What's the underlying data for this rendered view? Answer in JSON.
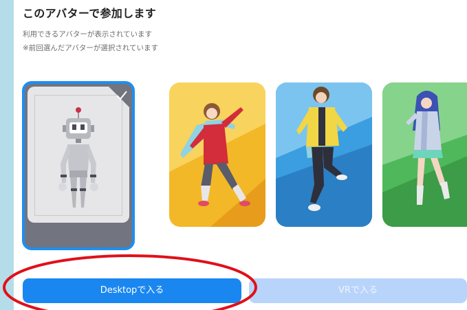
{
  "header": {
    "title": "このアバターで参加します",
    "subtitle_line1": "利用できるアバターが表示されています",
    "subtitle_line2": "※前回選んだアバターが選択されています"
  },
  "avatars": [
    {
      "name": "robot",
      "selected": true
    },
    {
      "name": "girl-red-hoodie",
      "selected": false
    },
    {
      "name": "boy-yellow-jacket",
      "selected": false
    },
    {
      "name": "girl-blue-hair",
      "selected": false
    }
  ],
  "buttons": {
    "desktop_label": "Desktopで入る",
    "vr_label": "VRで入る"
  },
  "colors": {
    "accent": "#1a87f0",
    "disabled": "#b9d4fb",
    "annotation": "#e0101a"
  }
}
